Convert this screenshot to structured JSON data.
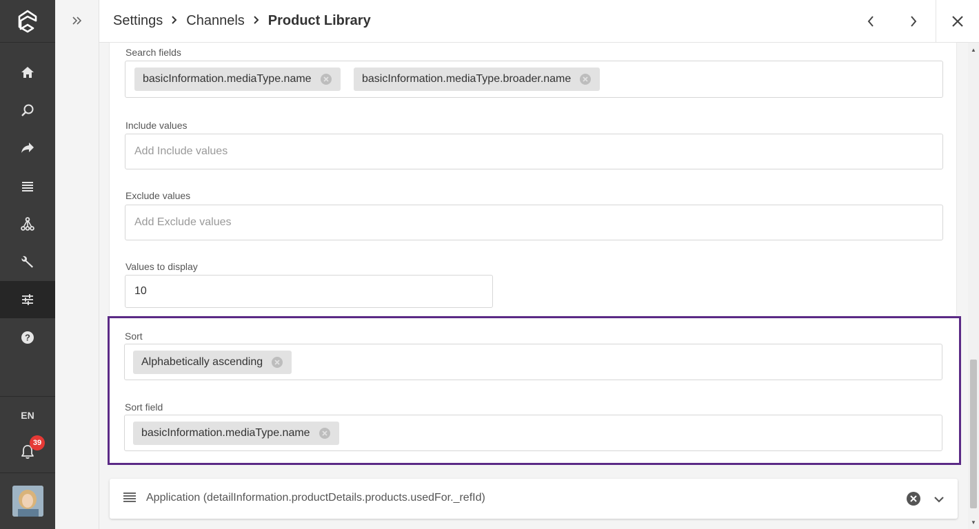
{
  "rail": {
    "items": [
      {
        "icon": "home-icon"
      },
      {
        "icon": "search-icon"
      },
      {
        "icon": "share-icon"
      },
      {
        "icon": "list-icon"
      },
      {
        "icon": "hierarchy-icon"
      },
      {
        "icon": "wrench-icon"
      },
      {
        "icon": "sliders-icon",
        "active": true
      },
      {
        "icon": "help-icon"
      }
    ],
    "language": "EN",
    "notification_count": "39"
  },
  "breadcrumb": {
    "items": [
      "Settings",
      "Channels"
    ],
    "current": "Product Library"
  },
  "form": {
    "search_fields": {
      "label": "Search fields",
      "chips": [
        "basicInformation.mediaType.name",
        "basicInformation.mediaType.broader.name"
      ]
    },
    "include_values": {
      "label": "Include values",
      "placeholder": "Add Include values"
    },
    "exclude_values": {
      "label": "Exclude values",
      "placeholder": "Add Exclude values"
    },
    "values_to_display": {
      "label": "Values to display",
      "value": "10"
    },
    "sort": {
      "label": "Sort",
      "chips": [
        "Alphabetically ascending"
      ]
    },
    "sort_field": {
      "label": "Sort field",
      "chips": [
        "basicInformation.mediaType.name"
      ]
    }
  },
  "accordion": {
    "title": "Application (detailInformation.productDetails.products.usedFor._refId)"
  },
  "colors": {
    "rail_bg": "#3b3b3b",
    "highlight_border": "#5b2a86",
    "badge": "#e53935"
  }
}
